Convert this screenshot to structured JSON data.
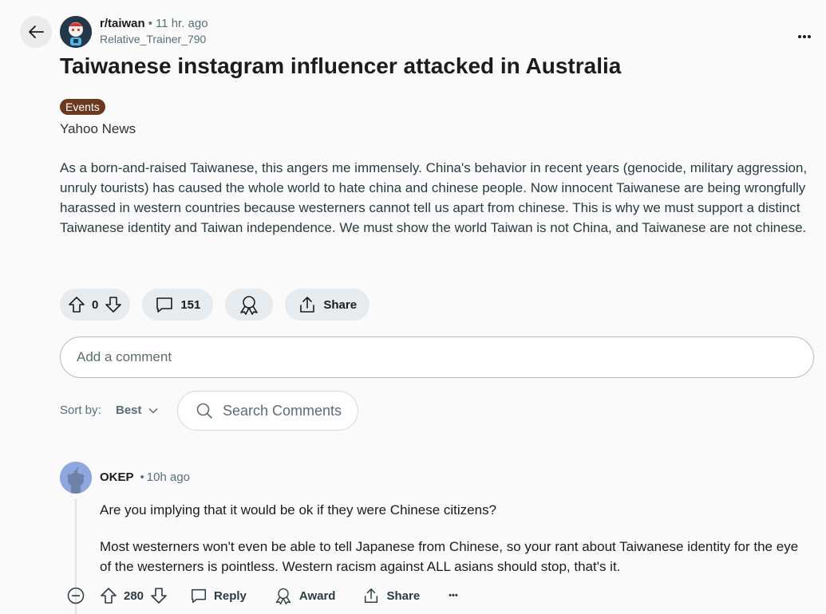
{
  "post": {
    "subreddit": "r/taiwan",
    "separator": "•",
    "time": "11 hr. ago",
    "author": "Relative_Trainer_790",
    "title": "Taiwanese instagram influencer attacked in Australia",
    "flair": "Events",
    "flair_color": "#6b3a1e",
    "source": "Yahoo News",
    "body": "As a born-and-raised Taiwanese, this angers me immensely. China's behavior in recent years (genocide, military aggression, unruly tourists) has caused the whole world to hate china and chinese people. Now innocent Taiwanese are being wrongfully harassed in western countries because westerners cannot tell us apart from chinese. This is why we must support a distinct Taiwanese identity and Taiwan independence. We must show the world Taiwan is not China, and Taiwanese are not chinese.",
    "score": "0",
    "comments_count": "151",
    "share_label": "Share",
    "icons": [
      "back-arrow-icon",
      "overflow-menu-icon",
      "upvote-icon",
      "downvote-icon",
      "comment-icon",
      "award-icon",
      "share-icon"
    ]
  },
  "comment_box": {
    "placeholder": "Add a comment"
  },
  "sort": {
    "label": "Sort by:",
    "value": "Best",
    "search_placeholder": "Search Comments"
  },
  "comment": {
    "author": "OKEP",
    "separator": "•",
    "time": "10h ago",
    "paragraph1": "Are you implying that it would be ok if they were Chinese citizens?",
    "paragraph2": "Most westerners won't even be able to tell Japanese from Chinese, so your rant about Taiwanese identity for the eye of the westerners is pointless. Western racism against ALL asians should stop, that's it.",
    "score": "280",
    "reply_label": "Reply",
    "award_label": "Award",
    "share_label": "Share",
    "more_label": "•••"
  }
}
